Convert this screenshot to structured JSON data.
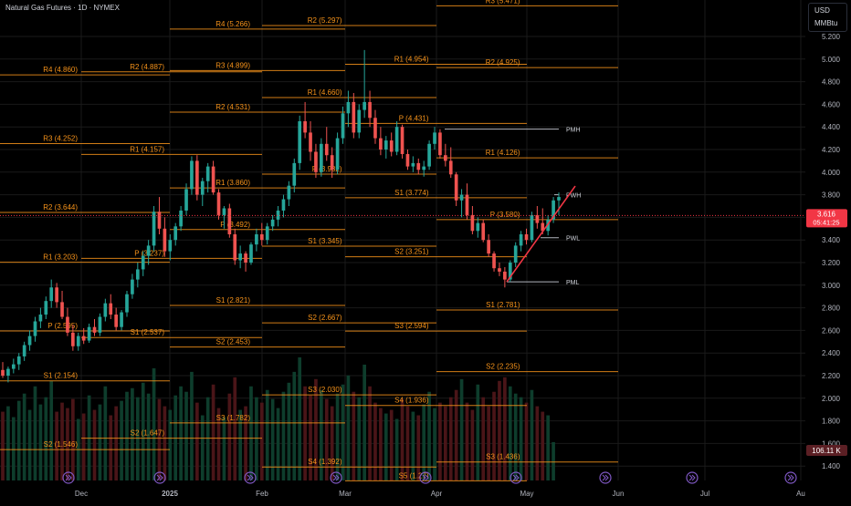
{
  "header": {
    "title": "Natural Gas Futures · 1D · NYMEX"
  },
  "units": {
    "currency": "USD",
    "quantity": "MMBtu"
  },
  "colors": {
    "background": "#000000",
    "pivot_line": "#f7931a",
    "candle_up": "#26a69a",
    "candle_down": "#ef5350",
    "volume_up": "#0e3d2c",
    "volume_down": "#4a1518",
    "prior_level_line": "#b2b5be",
    "trend_line": "#f23645",
    "axis_text": "#b2b5be",
    "grid": "#1a1a1a"
  },
  "price_badges": {
    "last_price": "3.616",
    "countdown": "05:41:25",
    "volume": "106.11 K"
  },
  "pivots": [
    {
      "label": "R4 (4.860)",
      "levels": [
        {
          "name": "R4",
          "value": 4.86
        },
        {
          "name": "R3",
          "value": 4.252
        },
        {
          "name": "R2",
          "value": 3.644
        },
        {
          "name": "R1",
          "value": 3.203
        },
        {
          "name": "P",
          "value": 2.595
        },
        {
          "name": "S1",
          "value": 2.154
        },
        {
          "name": "S2",
          "value": 1.546
        }
      ]
    },
    {
      "label": "",
      "levels": [
        {
          "name": "R2",
          "value": 4.887
        },
        {
          "name": "R1",
          "value": 4.157
        },
        {
          "name": "P",
          "value": 3.237
        },
        {
          "name": "S1",
          "value": 2.537
        },
        {
          "name": "S2",
          "value": 1.647
        }
      ]
    },
    {
      "label": "",
      "levels": [
        {
          "name": "R4",
          "value": 5.266
        },
        {
          "name": "R3",
          "value": 4.899
        },
        {
          "name": "R2",
          "value": 4.531
        },
        {
          "name": "R1",
          "value": 3.86
        },
        {
          "name": "P",
          "value": 3.492
        },
        {
          "name": "S1",
          "value": 2.821
        },
        {
          "name": "S2",
          "value": 2.453
        },
        {
          "name": "S3",
          "value": 1.782
        }
      ]
    },
    {
      "label": "",
      "levels": [
        {
          "name": "R2",
          "value": 5.297
        },
        {
          "name": "R1",
          "value": 4.66
        },
        {
          "name": "P",
          "value": 3.982
        },
        {
          "name": "S1",
          "value": 3.345
        },
        {
          "name": "S2",
          "value": 2.667
        },
        {
          "name": "S3",
          "value": 2.03
        },
        {
          "name": "S4",
          "value": 1.392
        }
      ]
    },
    {
      "label": "",
      "levels": [
        {
          "name": "R1",
          "value": 4.954
        },
        {
          "name": "P",
          "value": 4.431
        },
        {
          "name": "S1",
          "value": 3.774
        },
        {
          "name": "S2",
          "value": 3.251
        },
        {
          "name": "S3",
          "value": 2.594
        },
        {
          "name": "S4",
          "value": 1.936
        },
        {
          "name": "S5",
          "value": 1.27
        }
      ]
    },
    {
      "label": "",
      "levels": [
        {
          "name": "R3",
          "value": 5.471
        },
        {
          "name": "R2",
          "value": 4.925
        },
        {
          "name": "R1",
          "value": 4.126
        },
        {
          "name": "P",
          "value": 3.58
        },
        {
          "name": "S1",
          "value": 2.781
        },
        {
          "name": "S2",
          "value": 2.235
        },
        {
          "name": "S3",
          "value": 1.436
        }
      ]
    }
  ],
  "prior_levels": [
    {
      "label": "PMH",
      "value": 4.38
    },
    {
      "label": "PWH",
      "value": 3.8
    },
    {
      "label": "PWL",
      "value": 3.42
    },
    {
      "label": "PML",
      "value": 3.03
    }
  ],
  "chart_data": {
    "type": "candlestick",
    "title": "Natural Gas Futures · 1D · NYMEX",
    "y_axis_ticks": [
      "5.200",
      "5.000",
      "4.800",
      "4.600",
      "4.400",
      "4.200",
      "4.000",
      "3.800",
      "3.600",
      "3.400",
      "3.200",
      "3.000",
      "2.800",
      "2.600",
      "2.400",
      "2.200",
      "2.000",
      "1.800",
      "1.600",
      "1.400"
    ],
    "ylim": [
      1.28,
      5.3
    ],
    "x_axis_labels": [
      "Dec",
      "2025",
      "Feb",
      "Mar",
      "Apr",
      "May",
      "Jun",
      "Jul",
      "Au"
    ],
    "last_price": 3.616,
    "trend_line": {
      "from": {
        "date": "2025-04-28",
        "price": 3.03
      },
      "to": {
        "date": "2025-05-19",
        "price": 3.78
      }
    },
    "ohlc": [
      [
        2.25,
        2.32,
        2.18,
        2.2
      ],
      [
        2.2,
        2.28,
        2.14,
        2.26
      ],
      [
        2.26,
        2.35,
        2.22,
        2.3
      ],
      [
        2.3,
        2.4,
        2.25,
        2.37
      ],
      [
        2.37,
        2.5,
        2.33,
        2.47
      ],
      [
        2.47,
        2.6,
        2.42,
        2.55
      ],
      [
        2.55,
        2.72,
        2.5,
        2.68
      ],
      [
        2.68,
        2.8,
        2.62,
        2.74
      ],
      [
        2.74,
        2.9,
        2.7,
        2.86
      ],
      [
        2.86,
        3.05,
        2.8,
        2.98
      ],
      [
        2.98,
        3.02,
        2.8,
        2.85
      ],
      [
        2.85,
        2.95,
        2.7,
        2.72
      ],
      [
        2.72,
        2.8,
        2.55,
        2.58
      ],
      [
        2.58,
        2.65,
        2.42,
        2.46
      ],
      [
        2.46,
        2.58,
        2.42,
        2.55
      ],
      [
        2.55,
        2.62,
        2.48,
        2.51
      ],
      [
        2.51,
        2.66,
        2.49,
        2.63
      ],
      [
        2.63,
        2.7,
        2.55,
        2.58
      ],
      [
        2.58,
        2.75,
        2.55,
        2.72
      ],
      [
        2.72,
        2.88,
        2.68,
        2.84
      ],
      [
        2.84,
        2.92,
        2.7,
        2.74
      ],
      [
        2.74,
        2.8,
        2.6,
        2.63
      ],
      [
        2.63,
        2.78,
        2.6,
        2.76
      ],
      [
        2.76,
        2.95,
        2.72,
        2.92
      ],
      [
        2.92,
        3.1,
        2.88,
        3.05
      ],
      [
        3.05,
        3.2,
        2.98,
        3.14
      ],
      [
        3.14,
        3.3,
        3.08,
        3.26
      ],
      [
        3.26,
        3.4,
        3.18,
        3.35
      ],
      [
        3.35,
        3.7,
        3.3,
        3.65
      ],
      [
        3.65,
        3.78,
        3.45,
        3.5
      ],
      [
        3.5,
        3.6,
        3.25,
        3.3
      ],
      [
        3.3,
        3.45,
        3.22,
        3.4
      ],
      [
        3.4,
        3.55,
        3.35,
        3.52
      ],
      [
        3.52,
        3.7,
        3.48,
        3.66
      ],
      [
        3.66,
        3.9,
        3.62,
        3.85
      ],
      [
        3.85,
        4.14,
        3.8,
        4.1
      ],
      [
        4.1,
        4.15,
        3.75,
        3.8
      ],
      [
        3.8,
        3.95,
        3.7,
        3.92
      ],
      [
        3.92,
        4.08,
        3.82,
        4.05
      ],
      [
        4.05,
        4.1,
        3.8,
        3.82
      ],
      [
        3.82,
        3.85,
        3.58,
        3.62
      ],
      [
        3.62,
        3.7,
        3.5,
        3.68
      ],
      [
        3.68,
        3.72,
        3.42,
        3.45
      ],
      [
        3.45,
        3.5,
        3.18,
        3.22
      ],
      [
        3.22,
        3.35,
        3.15,
        3.28
      ],
      [
        3.28,
        3.3,
        3.12,
        3.2
      ],
      [
        3.2,
        3.38,
        3.18,
        3.36
      ],
      [
        3.36,
        3.5,
        3.3,
        3.45
      ],
      [
        3.45,
        3.55,
        3.35,
        3.4
      ],
      [
        3.4,
        3.55,
        3.36,
        3.52
      ],
      [
        3.52,
        3.62,
        3.48,
        3.58
      ],
      [
        3.58,
        3.7,
        3.52,
        3.66
      ],
      [
        3.66,
        3.8,
        3.6,
        3.76
      ],
      [
        3.76,
        3.92,
        3.7,
        3.88
      ],
      [
        3.88,
        4.12,
        3.82,
        4.08
      ],
      [
        4.08,
        4.5,
        4.02,
        4.45
      ],
      [
        4.45,
        4.62,
        4.3,
        4.35
      ],
      [
        4.35,
        4.45,
        4.1,
        4.18
      ],
      [
        4.18,
        4.25,
        3.95,
        4.0
      ],
      [
        4.0,
        4.3,
        3.96,
        4.25
      ],
      [
        4.25,
        4.4,
        4.1,
        4.15
      ],
      [
        4.15,
        4.22,
        3.95,
        4.02
      ],
      [
        4.02,
        4.35,
        3.98,
        4.3
      ],
      [
        4.3,
        4.58,
        4.25,
        4.52
      ],
      [
        4.52,
        4.72,
        4.4,
        4.62
      ],
      [
        4.62,
        4.7,
        4.3,
        4.35
      ],
      [
        4.35,
        4.6,
        4.3,
        4.55
      ],
      [
        4.55,
        5.08,
        4.48,
        4.62
      ],
      [
        4.62,
        4.72,
        4.4,
        4.48
      ],
      [
        4.48,
        4.55,
        4.25,
        4.3
      ],
      [
        4.3,
        4.4,
        4.15,
        4.2
      ],
      [
        4.2,
        4.32,
        4.12,
        4.28
      ],
      [
        4.28,
        4.35,
        4.14,
        4.18
      ],
      [
        4.18,
        4.45,
        4.15,
        4.4
      ],
      [
        4.4,
        4.42,
        4.12,
        4.16
      ],
      [
        4.16,
        4.2,
        4.02,
        4.05
      ],
      [
        4.05,
        4.14,
        4.0,
        4.08
      ],
      [
        4.08,
        4.12,
        3.98,
        4.02
      ],
      [
        4.02,
        4.1,
        3.96,
        4.05
      ],
      [
        4.05,
        4.28,
        4.02,
        4.25
      ],
      [
        4.25,
        4.4,
        4.2,
        4.35
      ],
      [
        4.35,
        4.38,
        4.12,
        4.15
      ],
      [
        4.15,
        4.25,
        4.05,
        4.1
      ],
      [
        4.1,
        4.22,
        3.95,
        3.98
      ],
      [
        3.98,
        4.0,
        3.7,
        3.75
      ],
      [
        3.75,
        3.85,
        3.6,
        3.8
      ],
      [
        3.8,
        3.9,
        3.58,
        3.62
      ],
      [
        3.62,
        3.7,
        3.45,
        3.48
      ],
      [
        3.48,
        3.6,
        3.42,
        3.55
      ],
      [
        3.55,
        3.58,
        3.38,
        3.4
      ],
      [
        3.4,
        3.45,
        3.25,
        3.28
      ],
      [
        3.28,
        3.3,
        3.12,
        3.15
      ],
      [
        3.15,
        3.2,
        3.08,
        3.12
      ],
      [
        3.12,
        3.16,
        2.98,
        3.05
      ],
      [
        3.05,
        3.22,
        3.03,
        3.2
      ],
      [
        3.2,
        3.38,
        3.16,
        3.35
      ],
      [
        3.35,
        3.48,
        3.3,
        3.45
      ],
      [
        3.45,
        3.5,
        3.36,
        3.4
      ],
      [
        3.4,
        3.65,
        3.38,
        3.62
      ],
      [
        3.62,
        3.7,
        3.5,
        3.55
      ],
      [
        3.55,
        3.68,
        3.45,
        3.48
      ],
      [
        3.48,
        3.62,
        3.44,
        3.58
      ],
      [
        3.58,
        3.78,
        3.55,
        3.75
      ],
      [
        3.75,
        3.82,
        3.62,
        3.78
      ]
    ],
    "volume_k": [
      190,
      205,
      175,
      220,
      240,
      195,
      260,
      210,
      230,
      275,
      190,
      215,
      200,
      225,
      170,
      185,
      235,
      195,
      210,
      260,
      180,
      205,
      220,
      245,
      255,
      230,
      270,
      240,
      310,
      225,
      205,
      195,
      235,
      260,
      245,
      300,
      215,
      180,
      230,
      265,
      200,
      175,
      240,
      285,
      195,
      205,
      260,
      230,
      215,
      250,
      225,
      200,
      245,
      270,
      300,
      340,
      260,
      235,
      280,
      250,
      225,
      205,
      240,
      265,
      290,
      245,
      230,
      320,
      260,
      215,
      200,
      185,
      195,
      170,
      225,
      205,
      190,
      180,
      210,
      245,
      200,
      215,
      205,
      230,
      250,
      280,
      215,
      195,
      265,
      230,
      205,
      245,
      275,
      285,
      260,
      240,
      230,
      215,
      250,
      205,
      190,
      180,
      106
    ]
  }
}
